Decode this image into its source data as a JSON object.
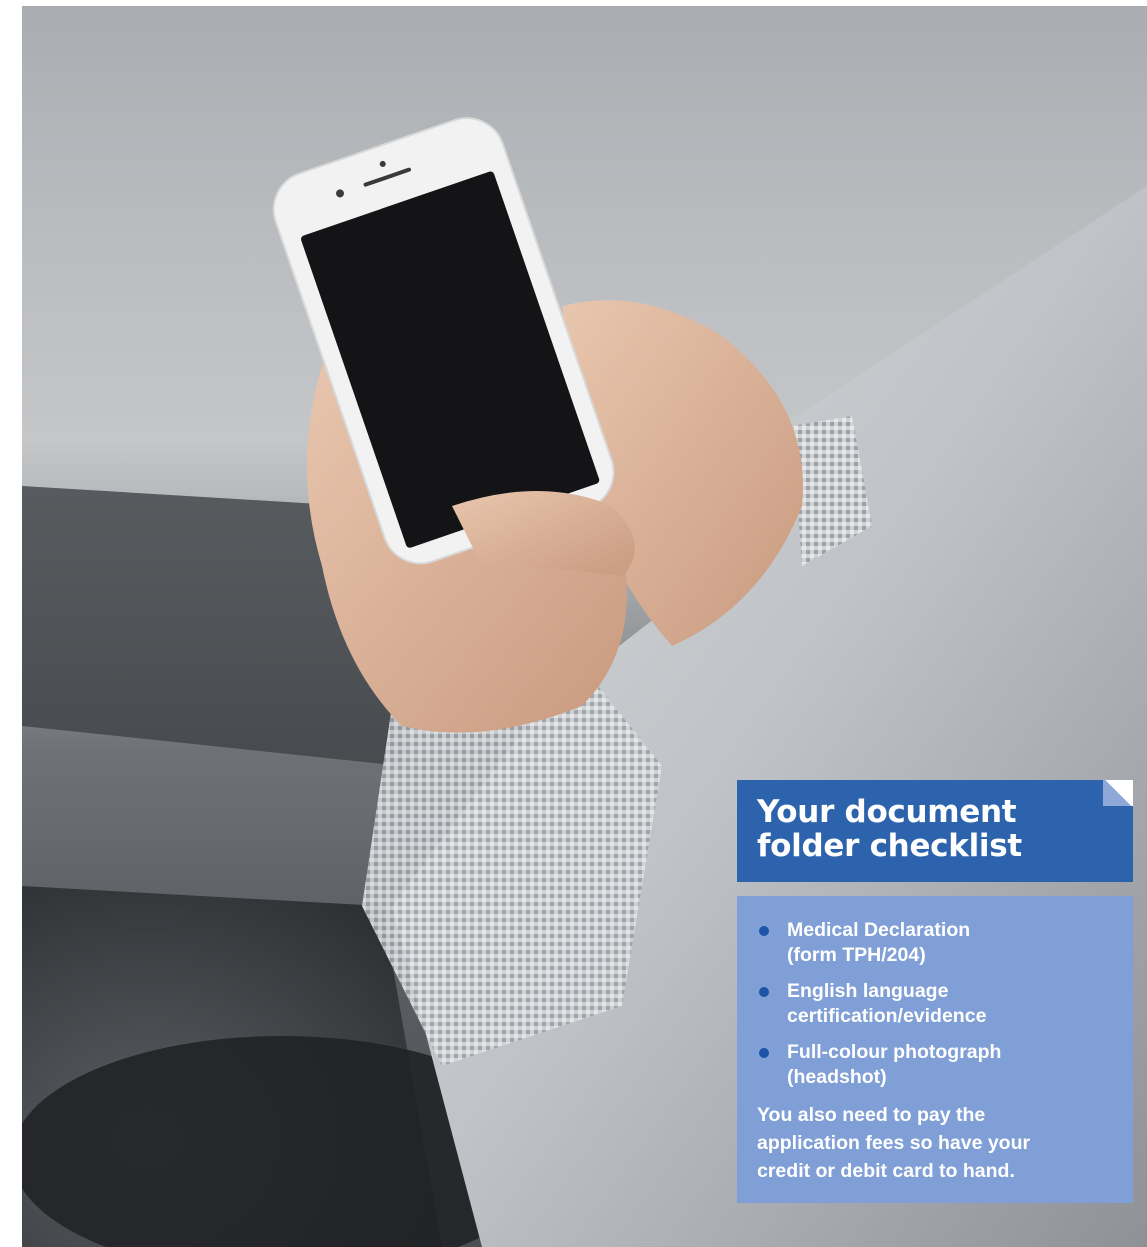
{
  "checklist": {
    "title_line1": "Your document",
    "title_line2": "folder checklist",
    "items": [
      {
        "line1": "Medical Declaration",
        "line2": "(form TPH/204)"
      },
      {
        "line1": "English language",
        "line2": "certification/evidence"
      },
      {
        "line1": "Full-colour photograph",
        "line2": "(headshot)"
      }
    ],
    "note_line1": "You also need to pay the",
    "note_line2": "application fees so have your",
    "note_line3": "credit or debit card to hand."
  },
  "colors": {
    "header_blue": "#2d63ac",
    "body_blue": "#7f9fd6",
    "bullet_blue": "#1d54a8"
  }
}
